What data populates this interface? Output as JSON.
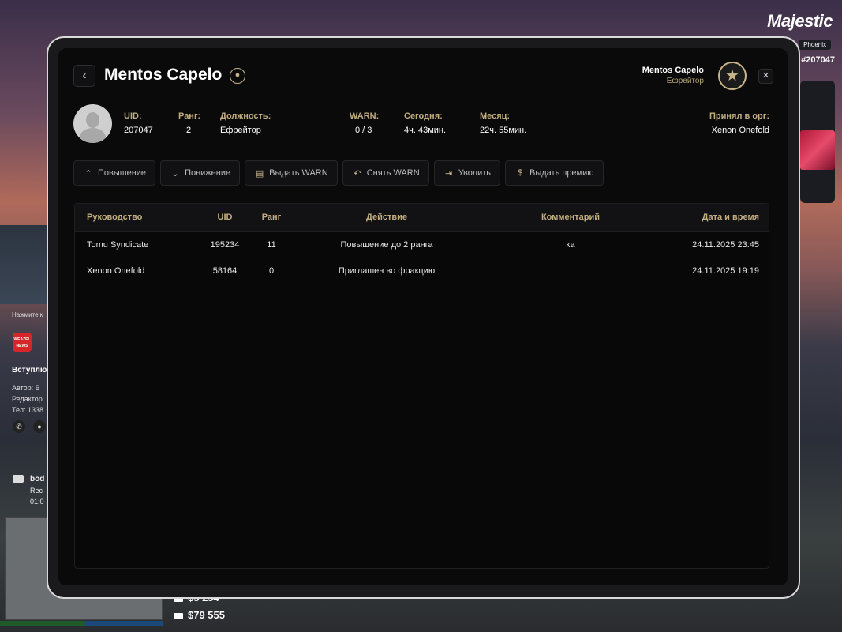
{
  "game_hud": {
    "brand": "Majestic",
    "server": "Phoenix",
    "player_uid": "#207047",
    "notification": {
      "hint": "Нажмите к",
      "logo_text": "WEAZEL NEWS",
      "title": "Вступлю",
      "meta_lines": [
        "Автор: В",
        "Редактор",
        "Тел: 1338"
      ],
      "video_title": "bod",
      "video_sub": "Rec",
      "video_time": "01:0"
    },
    "money": {
      "bank": "$5 254",
      "cash": "$79 555"
    }
  },
  "profile": {
    "name": "Mentos Capelo",
    "header_name": "Mentos Capelo",
    "header_role": "Ефрейтор",
    "fields": {
      "uid_label": "UID:",
      "uid_value": "207047",
      "rank_label": "Ранг:",
      "rank_value": "2",
      "position_label": "Должность:",
      "position_value": "Ефрейтор",
      "warn_label": "WARN:",
      "warn_value": "0 / 3",
      "today_label": "Сегодня:",
      "today_value": "4ч. 43мин.",
      "month_label": "Месяц:",
      "month_value": "22ч. 55мин.",
      "accepted_label": "Принял в орг:",
      "accepted_value": "Xenon Onefold"
    }
  },
  "actions": {
    "promote": "Повышение",
    "demote": "Понижение",
    "give_warn": "Выдать WARN",
    "remove_warn": "Снять WARN",
    "dismiss": "Уволить",
    "give_bonus": "Выдать премию"
  },
  "table": {
    "headers": {
      "leader": "Руководство",
      "uid": "UID",
      "rank": "Ранг",
      "action": "Действие",
      "comment": "Комментарий",
      "datetime": "Дата и время"
    },
    "rows": [
      {
        "leader": "Tomu Syndicate",
        "uid": "195234",
        "rank": "11",
        "action": "Повышение до 2 ранга",
        "comment": "ка",
        "datetime": "24.11.2025 23:45"
      },
      {
        "leader": "Xenon Onefold",
        "uid": "58164",
        "rank": "0",
        "action": "Приглашен во фракцию",
        "comment": "",
        "datetime": "24.11.2025 19:19"
      }
    ]
  }
}
